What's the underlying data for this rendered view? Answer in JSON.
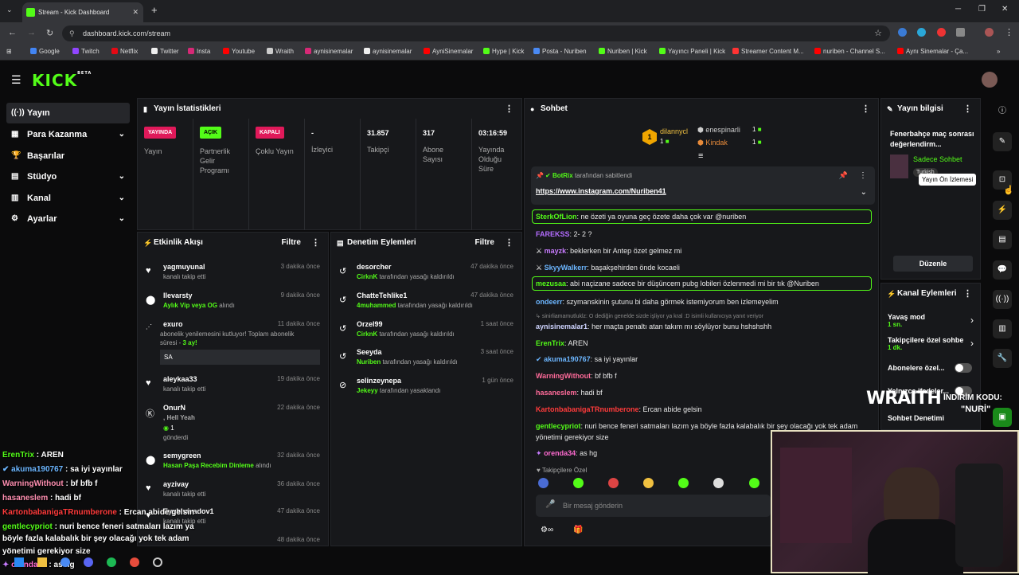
{
  "browser": {
    "tab_title": "Stream - Kick Dashboard",
    "url": "dashboard.kick.com/stream",
    "bookmarks": [
      "Google",
      "Twitch",
      "Netflix",
      "Twitter",
      "Insta",
      "Youtube",
      "Wraith",
      "aynisinemalar",
      "aynisinemalar",
      "AyniSinemalar",
      "Hype | Kick",
      "Posta - Nuriben",
      "Nuriben | Kick",
      "Yayıncı Paneli | Kick",
      "Streamer Content M...",
      "nuriben - Channel S...",
      "Aynı Sinemalar - Ça..."
    ]
  },
  "app": {
    "logo": "KICK",
    "logo_tag": "BETA"
  },
  "sidebar": {
    "items": [
      {
        "label": "Yayın",
        "icon": "((·))"
      },
      {
        "label": "Para Kazanma",
        "icon": "▦"
      },
      {
        "label": "Başarılar",
        "icon": "🏆"
      },
      {
        "label": "Stüdyo",
        "icon": "▤"
      },
      {
        "label": "Kanal",
        "icon": "▥"
      },
      {
        "label": "Ayarlar",
        "icon": "⚙"
      }
    ]
  },
  "stats": {
    "title": "Yayın İstatistikleri",
    "cols": [
      {
        "badge": "YAYINDA",
        "label": "Yayın",
        "color": "#e0195a"
      },
      {
        "badge": "AÇIK",
        "label": "Partnerlik Gelir Programı",
        "color": "#53fc18"
      },
      {
        "badge": "KAPALI",
        "label": "Çoklu Yayın",
        "color": "#e0195a"
      },
      {
        "value": "-",
        "label": "İzleyici"
      },
      {
        "value": "31.857",
        "label": "Takipçi"
      },
      {
        "value": "317",
        "label": "Abone Sayısı"
      },
      {
        "value": "03:16:59",
        "label": "Yayında Olduğu Süre"
      }
    ]
  },
  "activity": {
    "title": "Etkinlik Akışı",
    "filter": "Filtre",
    "items": [
      {
        "name": "yagmuyunal",
        "time": "3 dakika önce",
        "sub": "kanalı takip etti"
      },
      {
        "name": "llevarsty",
        "time": "9 dakika önce",
        "sub_green": "Aylık Vip veya OG",
        "sub": " alındı"
      },
      {
        "name": "exuro",
        "time": "11 dakika önce",
        "sub": "abonelik yenilemesini kutluyor! Toplam abonelik",
        "sub2": "süresi - ",
        "sub2_green": "3 ay!",
        "box": "SA"
      },
      {
        "name": "aleykaa33",
        "time": "19 dakika önce",
        "sub": "kanalı takip etti"
      },
      {
        "name": "OnurN",
        "time": "22 dakika önce",
        "sub_green": ", Hell Yeah",
        "sub2": "1",
        "sub3": "gönderdi"
      },
      {
        "name": "semygreen",
        "time": "32 dakika önce",
        "sub_green": "Hasan Paşa Recebim Dinleme",
        "sub": " alındı"
      },
      {
        "name": "ayzivay",
        "time": "36 dakika önce",
        "sub": "kanalı takip etti"
      },
      {
        "name": "Eyubhavadov1",
        "time": "47 dakika önce",
        "sub": "kanalı takip etti"
      },
      {
        "name": "",
        "time": "48 dakika önce",
        "sub": ""
      }
    ]
  },
  "moderation": {
    "title": "Denetim Eylemleri",
    "filter": "Filtre",
    "items": [
      {
        "name": "desorcher",
        "time": "47 dakika önce",
        "actor": "CirknK",
        "sub": " tarafından yasağı kaldırıldı"
      },
      {
        "name": "ChatteTehlike1",
        "time": "47 dakika önce",
        "actor": "4muhammed",
        "sub": " tarafından yasağı kaldırıldı"
      },
      {
        "name": "Orzel99",
        "time": "1 saat önce",
        "actor": "CirknK",
        "sub": " tarafından yasağı kaldırıldı"
      },
      {
        "name": "Seeyda",
        "time": "3 saat önce",
        "actor": "Nuriben",
        "sub": " tarafından yasağı kaldırıldı"
      },
      {
        "name": "selinzeynepa",
        "time": "1 gün önce",
        "actor": "Jekeyy",
        "sub": " tarafından yasaklandı"
      }
    ]
  },
  "chat": {
    "title": "Sohbet",
    "top": [
      {
        "rank": "1",
        "name": "dilannycl",
        "count": "1"
      },
      {
        "rank": "",
        "name": "enespinarli",
        "count": "1"
      },
      {
        "rank": "",
        "name": "Kindak",
        "count": "1"
      }
    ],
    "pinned_by": "BotRix",
    "pinned_suffix": "tarafından sabitlendi",
    "pinned_link": "https://www.instagram.com/Nuriben41",
    "messages": [
      {
        "user": "SterkOfLion",
        "color": "#53fc18",
        "text": "ne özeti ya oyuna geç özete daha çok var @nuriben",
        "hl": true
      },
      {
        "user": "FAREKSS",
        "color": "#b46cff",
        "text": "2- 2 ?"
      },
      {
        "user": "mayzk",
        "color": "#c87cff",
        "text": "beklerken bir Antep özet gelmez mi"
      },
      {
        "user": "SkyyWalkerr",
        "color": "#6cb6ff",
        "text": "başakşehirden önde kocaeli"
      },
      {
        "user": "mezusaa",
        "color": "#53fc18",
        "text": "abi naçizane sadece bir düşüncem pubg lobileri özlenmedi mi bir tık @Nuriben",
        "hl": true
      },
      {
        "user": "ondeerr",
        "color": "#6cb6ff",
        "text": "szymanskinin şutunu bi daha görmek istemiyorum ben izlemeyelim"
      },
      {
        "user": "",
        "color": "#888",
        "text": "sinirliamamutluklz: O dediğin genelde sizde işliyor ya kral :D isimli kullanıcıya yanıt veriyor",
        "reply": true
      },
      {
        "user": "aynisinemalar1",
        "color": "#cfd4ff",
        "text": "her maçta penaltı atan takım mı söylüyor bunu hshshshh"
      },
      {
        "user": "ErenTrix",
        "color": "#53fc18",
        "text": "AREN"
      },
      {
        "user": "akuma190767",
        "color": "#6cb6ff",
        "text": "sa iyi yayınlar"
      },
      {
        "user": "WarningWithout",
        "color": "#ff6b9a",
        "text": "bf bfb f"
      },
      {
        "user": "hasaneslem",
        "color": "#ff6b9a",
        "text": "hadi bf"
      },
      {
        "user": "KartonbabanigaTRnumberone",
        "color": "#ff3b3b",
        "text": "Ercan abide gelsin"
      },
      {
        "user": "gentlecypriot",
        "color": "#53fc18",
        "text": "nuri bence feneri satmaları lazım ya böyle fazla kalabalık bir şey olacağı yok tek adam"
      },
      {
        "user": "",
        "color": "#fff",
        "text": "yönetimi gerekiyor size"
      },
      {
        "user": "orenda34",
        "color": "#ff6bd1",
        "text": "as hg"
      }
    ],
    "followers_only": "Takipçilere Özel",
    "input_placeholder": "Bir mesaj gönderin"
  },
  "info": {
    "title": "Yayın bilgisi",
    "stream_title": "Fenerbahçe maç sonrası değerlendirm...",
    "category": "Sadece Sohbet",
    "language": "Turkish",
    "edit": "Düzenle",
    "tooltip": "Yayın Ön İzlemesi"
  },
  "channel_actions": {
    "title": "Kanal Eylemleri",
    "items": [
      {
        "label": "Yavaş mod",
        "sub": "1 sn."
      },
      {
        "label": "Takipçilere özel sohbe",
        "sub": "1 dk."
      },
      {
        "label": "Abonelere özel..."
      },
      {
        "label": "Yalnızca ifadeler..."
      },
      {
        "label": "Sohbet Denetimi"
      }
    ]
  },
  "overlay": {
    "wraith": "WRAITH",
    "code_label": "İNDİRİM KODU:",
    "code": "\"NURİ\"",
    "chat": [
      {
        "user": "ErenTrix",
        "color": "#53fc18",
        "text": " : AREN"
      },
      {
        "user": "akuma190767",
        "color": "#6cb6ff",
        "text": " : sa iyi yayınlar"
      },
      {
        "user": "WarningWithout",
        "color": "#ff8fb1",
        "text": " : bf bfb f"
      },
      {
        "user": "hasaneslem",
        "color": "#ff8fb1",
        "text": " : hadi bf"
      },
      {
        "user": "KartonbabanigaTRnumberone",
        "color": "#ff3b3b",
        "text": " : Ercan abide gelsin"
      },
      {
        "user": "gentlecypriot",
        "color": "#53fc18",
        "text": " : nuri bence feneri satmaları lazım ya"
      },
      {
        "user": "",
        "color": "#fff",
        "text": "böyle fazla kalabalık bir şey olacağı yok tek adam"
      },
      {
        "user": "",
        "color": "#fff",
        "text": "yönetimi gerekiyor size"
      },
      {
        "user": "orenda34",
        "color": "#ff6bd1",
        "text": " : as hg"
      }
    ]
  }
}
